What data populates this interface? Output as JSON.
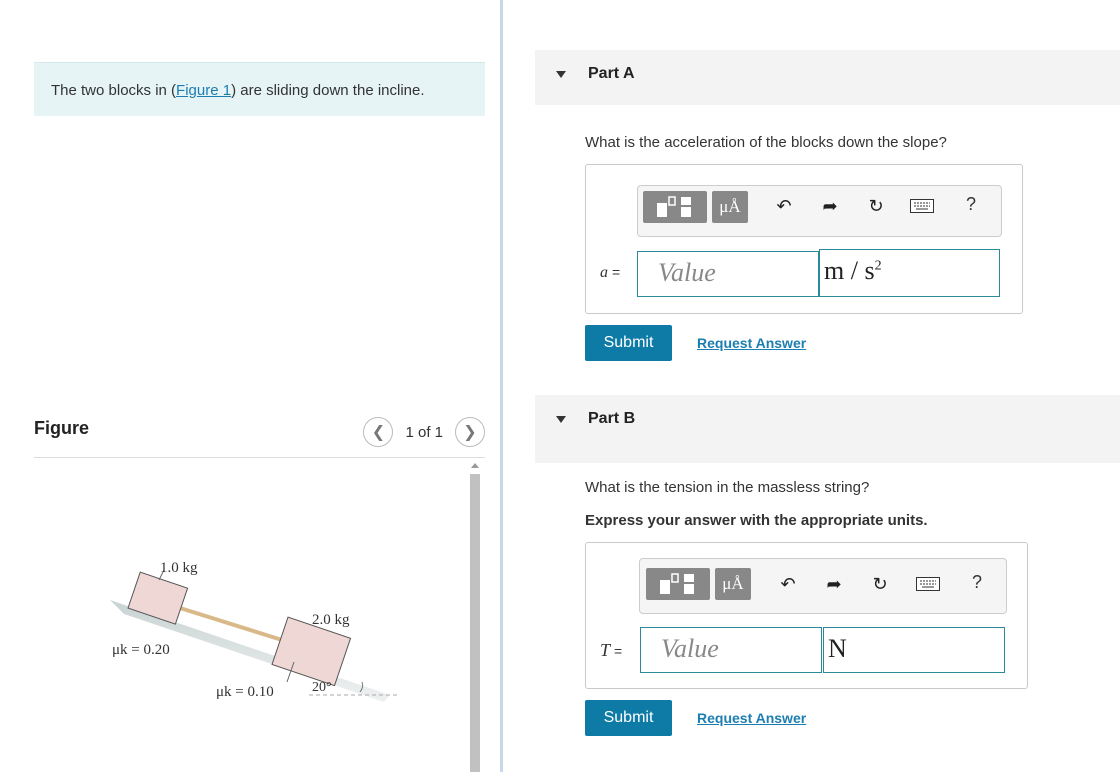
{
  "problem": {
    "text_before": "The two blocks in (",
    "link": "Figure 1",
    "text_after": ") are sliding down the incline."
  },
  "figure_panel": {
    "title": "Figure",
    "pager": "1 of 1",
    "prev_icon": "chevron-left-icon",
    "next_icon": "chevron-right-icon",
    "labels": {
      "mass1": "1.0 kg",
      "mass2": "2.0 kg",
      "mu1": "μk = 0.20",
      "mu2": "μk = 0.10",
      "angle": "20°"
    }
  },
  "toolbar": {
    "mu_label": "μÅ",
    "icons": [
      "templates-icon",
      "symbols-icon",
      "undo-icon",
      "redo-icon",
      "reset-icon",
      "keyboard-icon",
      "help-icon"
    ],
    "help": "?"
  },
  "partA": {
    "title": "Part A",
    "question": "What is the acceleration of the blocks down the slope?",
    "variable": "a",
    "equals": "=",
    "value_placeholder": "Value",
    "unit_base": "m / s",
    "unit_exp": "2",
    "submit": "Submit",
    "request": "Request Answer"
  },
  "partB": {
    "title": "Part B",
    "question": "What is the tension in the massless string?",
    "instruction": "Express your answer with the appropriate units.",
    "variable": "T",
    "equals": "=",
    "value_placeholder": "Value",
    "unit": "N",
    "submit": "Submit",
    "request": "Request Answer"
  },
  "colors": {
    "accent": "#0e7aa6",
    "link": "#1c7eb0",
    "problem_bg": "#e6f4f6",
    "input_border": "#2a8a9a"
  }
}
